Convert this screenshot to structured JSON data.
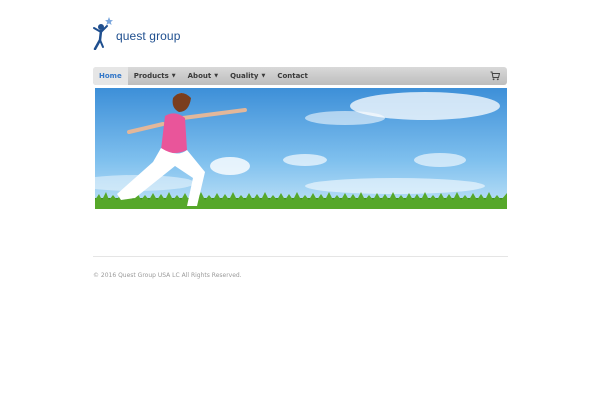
{
  "logo": {
    "text": "quest group"
  },
  "nav": {
    "items": [
      {
        "label": "Home",
        "active": true,
        "dropdown": false
      },
      {
        "label": "Products",
        "active": false,
        "dropdown": true
      },
      {
        "label": "About",
        "active": false,
        "dropdown": true
      },
      {
        "label": "Quality",
        "active": false,
        "dropdown": true
      },
      {
        "label": "Contact",
        "active": false,
        "dropdown": false
      }
    ],
    "cart_icon": "shopping-cart-icon"
  },
  "hero": {
    "icon": "woman-yoga-pose-image"
  },
  "footer": {
    "copyright": "© 2016 Quest Group USA LC All Rights Reserved."
  },
  "colors": {
    "brand": "#1f4f8f",
    "active_nav": "#3377c8",
    "navbar_bg": "#c8c8c8"
  }
}
